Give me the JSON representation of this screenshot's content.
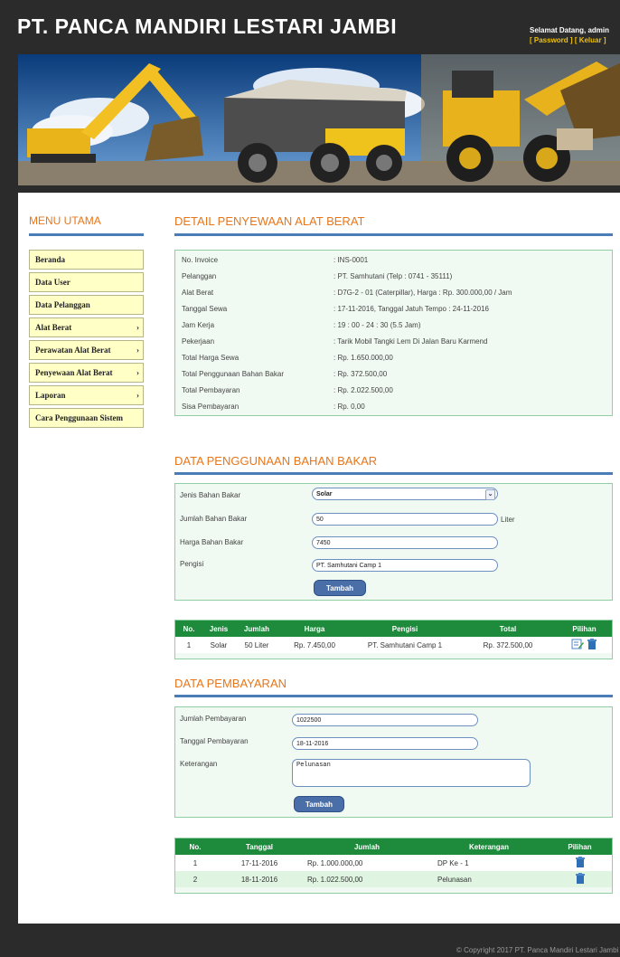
{
  "header": {
    "site_title": "PT. PANCA MANDIRI LESTARI JAMBI",
    "welcome": "Selamat Datang, admin",
    "password_link": "[ Password ]",
    "logout_link": "[ Keluar ]"
  },
  "menu": {
    "title": "MENU UTAMA",
    "items": [
      {
        "label": "Beranda"
      },
      {
        "label": "Data User"
      },
      {
        "label": "Data Pelanggan"
      },
      {
        "label": "Alat Berat",
        "arrow": "›"
      },
      {
        "label": "Perawatan Alat Berat",
        "arrow": "›"
      },
      {
        "label": "Penyewaan Alat Berat",
        "arrow": "›"
      },
      {
        "label": "Laporan",
        "arrow": "›"
      },
      {
        "label": "Cara Penggunaan Sistem"
      }
    ]
  },
  "detail": {
    "title": "DETAIL PENYEWAAN ALAT BERAT",
    "rows": [
      {
        "label": "No. Invoice",
        "value": ": INS-0001"
      },
      {
        "label": "Pelanggan",
        "value": ": PT. Samhutani (Telp : 0741 - 35111)"
      },
      {
        "label": "Alat Berat",
        "value": ": D7G-2 - 01 (Caterpillar), Harga : Rp. 300.000,00 / Jam"
      },
      {
        "label": "Tanggal Sewa",
        "value": ": 17-11-2016, Tanggal Jatuh Tempo : 24-11-2016"
      },
      {
        "label": "Jam Kerja",
        "value": ": 19 : 00 - 24 : 30 (5.5 Jam)"
      },
      {
        "label": "Pekerjaan",
        "value": ": Tarik Mobil Tangki Lem Di Jalan Baru Karmend"
      },
      {
        "label": "Total Harga Sewa",
        "value": ": Rp. 1.650.000,00"
      },
      {
        "label": "Total Penggunaan Bahan Bakar",
        "value": ": Rp. 372.500,00"
      },
      {
        "label": "Total Pembayaran",
        "value": ": Rp. 2.022.500,00"
      },
      {
        "label": "Sisa Pembayaran",
        "value": ": Rp. 0,00"
      }
    ]
  },
  "fuel_form": {
    "title": "DATA PENGGUNAAN BAHAN BAKAR",
    "jenis_label": "Jenis Bahan Bakar",
    "jenis_value": "Solar",
    "jumlah_label": "Jumlah Bahan Bakar",
    "jumlah_value": "50",
    "jumlah_suffix": "Liter",
    "harga_label": "Harga Bahan Bakar",
    "harga_value": "7450",
    "pengisi_label": "Pengisi",
    "pengisi_value": "PT. Samhutani Camp 1",
    "submit": "Tambah"
  },
  "fuel_table": {
    "headers": [
      "No.",
      "Jenis",
      "Jumlah",
      "Harga",
      "Pengisi",
      "Total",
      "Pilihan"
    ],
    "rows": [
      {
        "no": "1",
        "jenis": "Solar",
        "jumlah": "50 Liter",
        "harga": "Rp. 7.450,00",
        "pengisi": "PT. Samhutani Camp 1",
        "total": "Rp. 372.500,00"
      }
    ]
  },
  "payment_form": {
    "title": "DATA PEMBAYARAN",
    "jumlah_label": "Jumlah Pembayaran",
    "jumlah_value": "1022500",
    "tanggal_label": "Tanggal Pembayaran",
    "tanggal_value": "18-11-2016",
    "ket_label": "Keterangan",
    "ket_value": "Pelunasan",
    "submit": "Tambah"
  },
  "payment_table": {
    "headers": [
      "No.",
      "Tanggal",
      "Jumlah",
      "Keterangan",
      "Pilihan"
    ],
    "rows": [
      {
        "no": "1",
        "tanggal": "17-11-2016",
        "jumlah": "Rp. 1.000.000,00",
        "keterangan": "DP Ke - 1"
      },
      {
        "no": "2",
        "tanggal": "18-11-2016",
        "jumlah": "Rp. 1.022.500,00",
        "keterangan": "Pelunasan"
      }
    ]
  },
  "footer": {
    "copyright": "© Copyright 2017 PT. Panca Mandiri Lestari Jambi"
  }
}
